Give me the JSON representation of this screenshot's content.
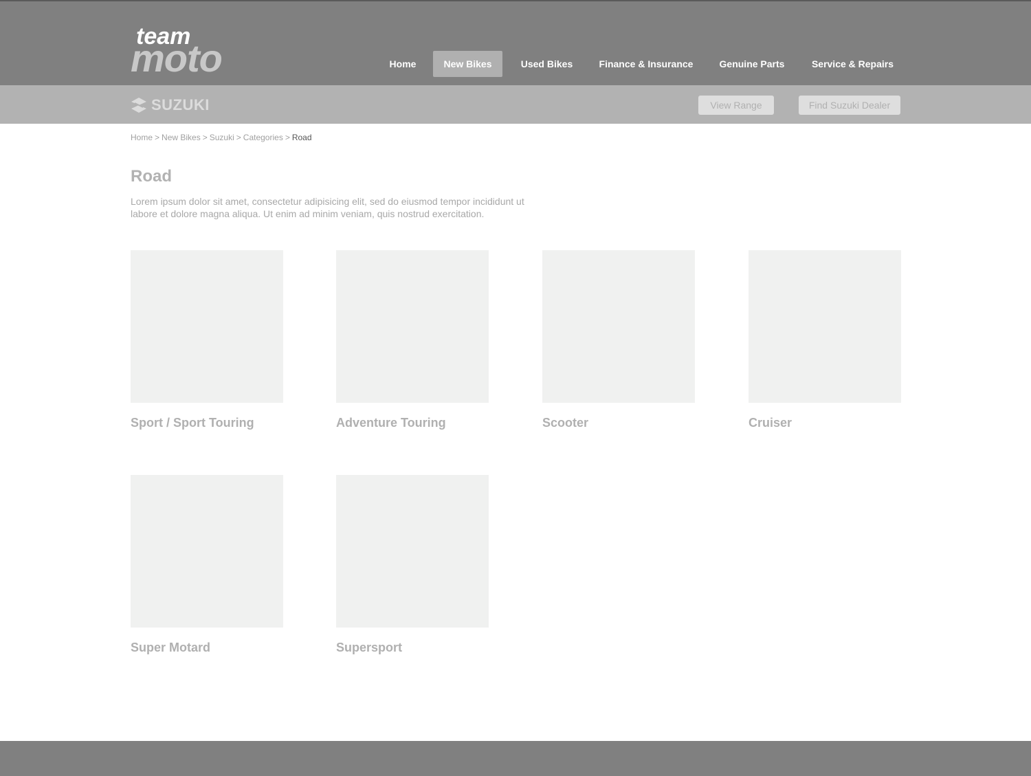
{
  "header": {
    "logo_text_top": "team",
    "logo_text_bottom": "moto",
    "nav": [
      {
        "label": "Home",
        "active": false
      },
      {
        "label": "New Bikes",
        "active": true
      },
      {
        "label": "Used Bikes",
        "active": false
      },
      {
        "label": "Finance & Insurance",
        "active": false
      },
      {
        "label": "Genuine Parts",
        "active": false
      },
      {
        "label": "Service & Repairs",
        "active": false
      }
    ]
  },
  "subheader": {
    "brand_name": "SUZUKI",
    "brand_icon": "suzuki-s-icon",
    "view_range_label": "View Range",
    "find_dealer_label": "Find Suzuki Dealer"
  },
  "breadcrumb": {
    "items": [
      "Home",
      "New Bikes",
      "Suzuki",
      "Categories"
    ],
    "separator": ">",
    "current": "Road"
  },
  "main": {
    "title": "Road",
    "intro": "Lorem ipsum dolor sit amet, consectetur adipisicing elit, sed do eiusmod tempor incididunt ut labore et dolore magna aliqua. Ut enim ad minim veniam, quis nostrud exercitation.",
    "categories": [
      {
        "label": "Sport / Sport Touring"
      },
      {
        "label": "Adventure Touring"
      },
      {
        "label": "Scooter"
      },
      {
        "label": "Cruiser"
      },
      {
        "label": "Super Motard"
      },
      {
        "label": "Supersport"
      }
    ]
  },
  "colors": {
    "header_bg": "#808080",
    "subheader_bg": "#b2b2b2",
    "placeholder_bg": "#f0f1f0",
    "footer_bg": "#808080"
  }
}
